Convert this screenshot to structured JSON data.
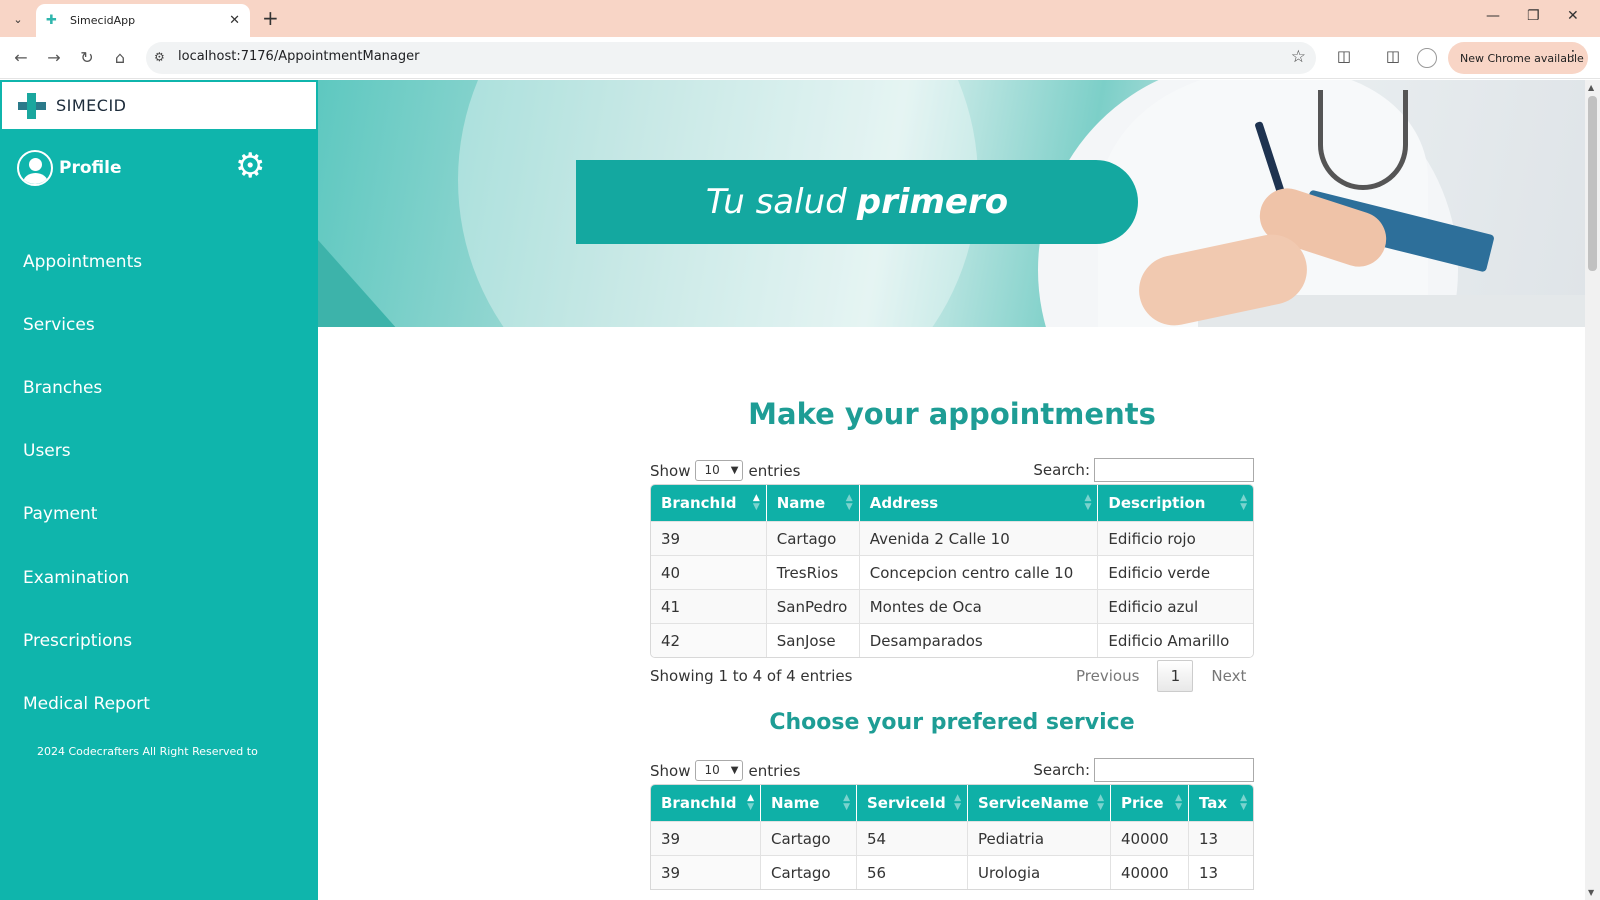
{
  "browser": {
    "tab_title": "SimecidApp",
    "url": "localhost:7176/AppointmentManager",
    "update_chip": "New Chrome available"
  },
  "sidebar": {
    "brand": "SIMECID",
    "profile_label": "Profile",
    "items": [
      {
        "label": "Appointments"
      },
      {
        "label": "Services"
      },
      {
        "label": "Branches"
      },
      {
        "label": "Users"
      },
      {
        "label": "Payment"
      },
      {
        "label": "Examination"
      },
      {
        "label": "Prescriptions"
      },
      {
        "label": "Medical Report"
      }
    ],
    "footer": "2024 Codecrafters All Right Reserved to"
  },
  "banner": {
    "slogan_light": "Tu salud",
    "slogan_bold": "primero"
  },
  "appointments": {
    "title": "Make your appointments",
    "show_label": "Show",
    "entries_value": "10",
    "entries_label": "entries",
    "search_label": "Search:",
    "columns": [
      "BranchId",
      "Name",
      "Address",
      "Description"
    ],
    "rows": [
      [
        "39",
        "Cartago",
        "Avenida 2 Calle 10",
        "Edificio rojo"
      ],
      [
        "40",
        "TresRios",
        "Concepcion centro calle 10",
        "Edificio verde"
      ],
      [
        "41",
        "SanPedro",
        "Montes de Oca",
        "Edificio azul"
      ],
      [
        "42",
        "SanJose",
        "Desamparados",
        "Edificio Amarillo"
      ]
    ],
    "info": "Showing 1 to 4 of 4 entries",
    "previous": "Previous",
    "page": "1",
    "next": "Next"
  },
  "services": {
    "title": "Choose your prefered service",
    "show_label": "Show",
    "entries_value": "10",
    "entries_label": "entries",
    "search_label": "Search:",
    "columns": [
      "BranchId",
      "Name",
      "ServiceId",
      "ServiceName",
      "Price",
      "Tax"
    ],
    "rows": [
      [
        "39",
        "Cartago",
        "54",
        "Pediatria",
        "40000",
        "13"
      ],
      [
        "39",
        "Cartago",
        "56",
        "Urologia",
        "40000",
        "13"
      ]
    ]
  }
}
